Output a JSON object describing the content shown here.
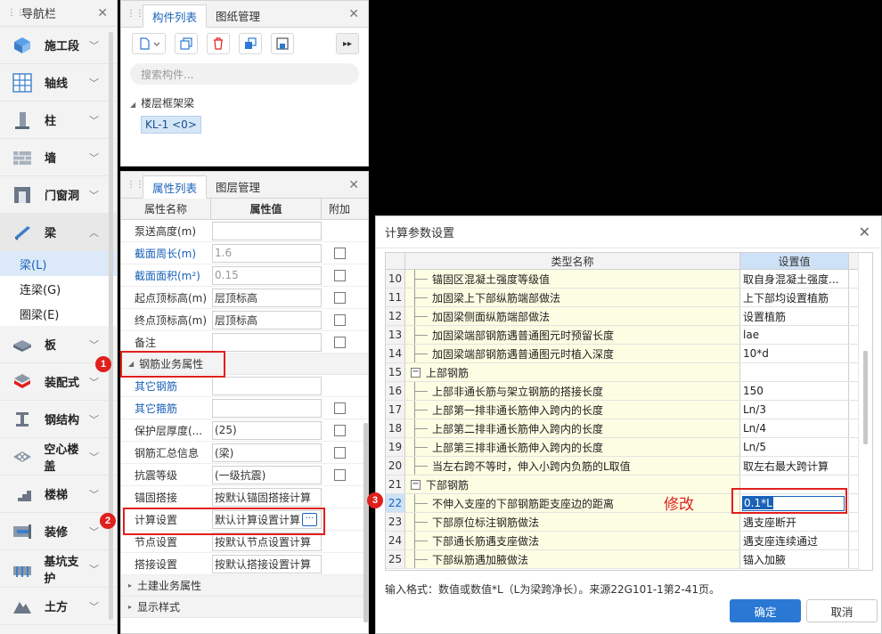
{
  "nav": {
    "title": "导航栏",
    "items": [
      {
        "label": "施工段"
      },
      {
        "label": "轴线"
      },
      {
        "label": "柱"
      },
      {
        "label": "墙"
      },
      {
        "label": "门窗洞"
      },
      {
        "label": "梁"
      }
    ],
    "sub_items": [
      {
        "label": "梁(L)"
      },
      {
        "label": "连梁(G)"
      },
      {
        "label": "圈梁(E)"
      }
    ],
    "items_after": [
      {
        "label": "板"
      },
      {
        "label": "装配式"
      },
      {
        "label": "钢结构"
      },
      {
        "label": "空心楼盖"
      },
      {
        "label": "楼梯"
      },
      {
        "label": "装修"
      },
      {
        "label": "基坑支护"
      },
      {
        "label": "土方"
      }
    ]
  },
  "component_panel": {
    "tabs": [
      "构件列表",
      "图纸管理"
    ],
    "search_placeholder": "搜索构件...",
    "tree_node": "楼层框架梁",
    "tree_leaf": "KL-1 <0>"
  },
  "property_panel": {
    "tabs": [
      "属性列表",
      "图层管理"
    ],
    "headers": [
      "属性名称",
      "属性值",
      "附加"
    ],
    "rows_top": [
      {
        "name": "泵送高度(m)",
        "value": "",
        "blue": false,
        "gray": false,
        "check": false
      },
      {
        "name": "截面周长(m)",
        "value": "1.6",
        "blue": true,
        "gray": true,
        "check": true
      },
      {
        "name": "截面面积(m²)",
        "value": "0.15",
        "blue": true,
        "gray": true,
        "check": true
      },
      {
        "name": "起点顶标高(m)",
        "value": "层顶标高",
        "blue": false,
        "gray": false,
        "check": true
      },
      {
        "name": "终点顶标高(m)",
        "value": "层顶标高",
        "blue": false,
        "gray": false,
        "check": true
      },
      {
        "name": "备注",
        "value": "",
        "blue": false,
        "gray": false,
        "check": true
      }
    ],
    "group_rebar": "钢筋业务属性",
    "rows_rebar": [
      {
        "name": "其它钢筋",
        "value": "",
        "blue": true,
        "check": false
      },
      {
        "name": "其它箍筋",
        "value": "",
        "blue": true,
        "check": true
      },
      {
        "name": "保护层厚度(...",
        "value": "(25)",
        "blue": false,
        "check": true
      },
      {
        "name": "钢筋汇总信息",
        "value": "(梁)",
        "blue": false,
        "check": true
      },
      {
        "name": "抗震等级",
        "value": "(一级抗震)",
        "blue": false,
        "check": true
      },
      {
        "name": "锚固搭接",
        "value": "按默认锚固搭接计算",
        "blue": false,
        "check": false
      },
      {
        "name": "计算设置",
        "value": "默认计算设置计算",
        "blue": false,
        "check": false
      },
      {
        "name": "节点设置",
        "value": "按默认节点设置计算",
        "blue": false,
        "check": false
      },
      {
        "name": "搭接设置",
        "value": "按默认搭接设置计算",
        "blue": false,
        "check": false
      }
    ],
    "group_civil": "土建业务属性",
    "group_display": "显示样式",
    "ellipsis": "···"
  },
  "markers": [
    "1",
    "2",
    "3"
  ],
  "dialog": {
    "title": "计算参数设置",
    "col_name": "类型名称",
    "col_value": "设置值",
    "rows": [
      {
        "num": "10",
        "name": "锚固区混凝土强度等级值",
        "value": "取自身混凝土强度...",
        "group": false
      },
      {
        "num": "11",
        "name": "加固梁上下部纵筋端部做法",
        "value": "上下部均设置植筋",
        "group": false
      },
      {
        "num": "12",
        "name": "加固梁侧面纵筋端部做法",
        "value": "设置植筋",
        "group": false
      },
      {
        "num": "13",
        "name": "加固梁端部钢筋遇普通图元时预留长度",
        "value": "lae",
        "group": false
      },
      {
        "num": "14",
        "name": "加固梁端部钢筋遇普通图元时植入深度",
        "value": "10*d",
        "group": false
      },
      {
        "num": "15",
        "name": "上部钢筋",
        "value": "",
        "group": true
      },
      {
        "num": "16",
        "name": "上部非通长筋与架立钢筋的搭接长度",
        "value": "150",
        "group": false
      },
      {
        "num": "17",
        "name": "上部第一排非通长筋伸入跨内的长度",
        "value": "Ln/3",
        "group": false
      },
      {
        "num": "18",
        "name": "上部第二排非通长筋伸入跨内的长度",
        "value": "Ln/4",
        "group": false
      },
      {
        "num": "19",
        "name": "上部第三排非通长筋伸入跨内的长度",
        "value": "Ln/5",
        "group": false
      },
      {
        "num": "20",
        "name": "当左右跨不等时，伸入小跨内负筋的L取值",
        "value": "取左右最大跨计算",
        "group": false
      },
      {
        "num": "21",
        "name": "下部钢筋",
        "value": "",
        "group": true
      },
      {
        "num": "22",
        "name": "不伸入支座的下部钢筋距支座边的距离",
        "value": "0.1*L",
        "group": false,
        "selected": true
      },
      {
        "num": "23",
        "name": "下部原位标注钢筋做法",
        "value": "遇支座断开",
        "group": false
      },
      {
        "num": "24",
        "name": "下部通长筋遇支座做法",
        "value": "遇支座连续通过",
        "group": false
      },
      {
        "num": "25",
        "name": "下部纵筋遇加腋做法",
        "value": "锚入加腋",
        "group": false
      }
    ],
    "hint": "输入格式：数值或数值*L（L为梁跨净长）。来源22G101-1第2-41页。",
    "ok": "确定",
    "cancel": "取消",
    "annotation": "修改"
  },
  "colors": {
    "accent": "#2b78d4",
    "highlight": "#e0201d"
  }
}
